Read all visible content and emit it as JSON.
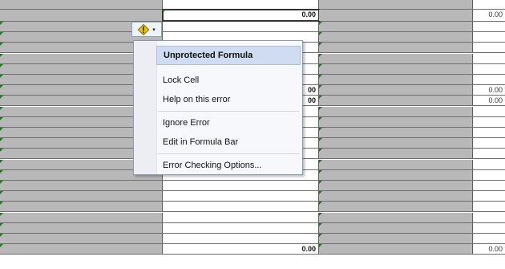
{
  "cells": {
    "b_row1": "0.00",
    "b_row7": "00",
    "b_row8": "00",
    "b_last": "0.00",
    "d_row1": "0.00",
    "d_row7": "0.00",
    "d_row8": "0.00",
    "d_last": "0.00"
  },
  "smart_tag": {
    "icon": "warning-diamond-icon",
    "dropdown_icon": "dropdown-arrow-icon",
    "arrow": "▾"
  },
  "error_menu": {
    "header": "Unprotected Formula",
    "items": [
      {
        "label": "Lock Cell"
      },
      {
        "label": "Help on this error"
      },
      {
        "label": "Ignore Error"
      },
      {
        "label": "Edit in Formula Bar"
      },
      {
        "label": "Error Checking Options..."
      }
    ]
  },
  "colors": {
    "locked_cell_gray": "#b8b8b8",
    "unlocked_cell": "#ffffff",
    "error_triangle": "#1f7a1f",
    "warning_yellow": "#f2c200",
    "menu_highlight": "#cfdcf1"
  }
}
